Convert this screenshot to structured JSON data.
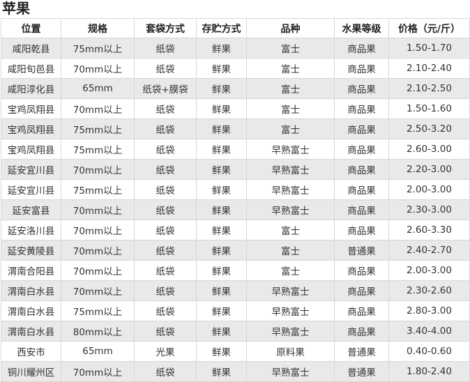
{
  "title": "苹果",
  "table": {
    "headers": [
      "位置",
      "规格",
      "套袋方式",
      "存贮方式",
      "品种",
      "水果等级",
      "价格（元/斤）"
    ],
    "rows": [
      [
        "咸阳乾县",
        "75mm以上",
        "纸袋",
        "鲜果",
        "富士",
        "商品果",
        "1.50-1.70"
      ],
      [
        "咸阳旬邑县",
        "70mm以上",
        "纸袋",
        "鲜果",
        "富士",
        "商品果",
        "2.10-2.40"
      ],
      [
        "咸阳淳化县",
        "65mm",
        "纸袋+膜袋",
        "鲜果",
        "富士",
        "商品果",
        "2.10-2.50"
      ],
      [
        "宝鸡凤翔县",
        "70mm以上",
        "纸袋",
        "鲜果",
        "富士",
        "商品果",
        "1.50-1.60"
      ],
      [
        "宝鸡凤翔县",
        "75mm以上",
        "纸袋",
        "鲜果",
        "富士",
        "商品果",
        "2.50-3.20"
      ],
      [
        "宝鸡凤翔县",
        "75mm以上",
        "纸袋",
        "鲜果",
        "早熟富士",
        "商品果",
        "2.60-3.00"
      ],
      [
        "延安宜川县",
        "70mm以上",
        "纸袋",
        "鲜果",
        "早熟富士",
        "商品果",
        "2.20-3.00"
      ],
      [
        "延安宜川县",
        "75mm以上",
        "纸袋",
        "鲜果",
        "早熟富士",
        "商品果",
        "2.00-3.00"
      ],
      [
        "延安富县",
        "70mm以上",
        "纸袋",
        "鲜果",
        "早熟富士",
        "商品果",
        "2.30-3.00"
      ],
      [
        "延安洛川县",
        "70mm以上",
        "纸袋",
        "鲜果",
        "富士",
        "商品果",
        "2.60-3.30"
      ],
      [
        "延安黄陵县",
        "70mm以上",
        "纸袋",
        "鲜果",
        "富士",
        "普通果",
        "2.40-2.70"
      ],
      [
        "渭南合阳县",
        "70mm以上",
        "纸袋",
        "鲜果",
        "富士",
        "商品果",
        "2.00-3.00"
      ],
      [
        "渭南白水县",
        "70mm以上",
        "纸袋",
        "鲜果",
        "早熟富士",
        "商品果",
        "2.30-2.60"
      ],
      [
        "渭南白水县",
        "75mm以上",
        "纸袋",
        "鲜果",
        "早熟富士",
        "商品果",
        "2.80-3.00"
      ],
      [
        "渭南白水县",
        "80mm以上",
        "纸袋",
        "鲜果",
        "早熟富士",
        "商品果",
        "3.40-4.00"
      ],
      [
        "西安市",
        "65mm",
        "光果",
        "鲜果",
        "原料果",
        "普通果",
        "0.40-0.60"
      ],
      [
        "铜川耀州区",
        "70mm以上",
        "纸袋",
        "鲜果",
        "早熟富士",
        "普通果",
        "1.80-2.40"
      ]
    ]
  }
}
